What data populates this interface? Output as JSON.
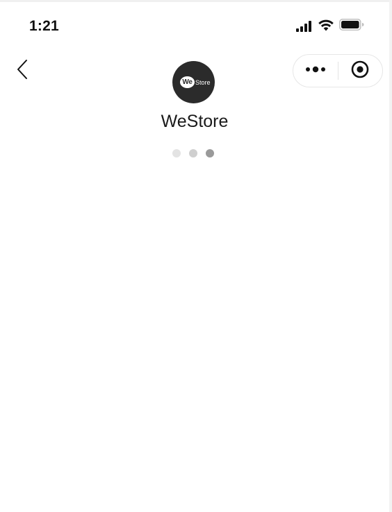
{
  "status_bar": {
    "time": "1:21",
    "icons": [
      "cellular-signal-icon",
      "wifi-icon",
      "battery-icon"
    ]
  },
  "nav": {
    "back_icon": "chevron-left-icon",
    "capsule": {
      "more_icon": "more-dots-icon",
      "close_icon": "target-close-icon"
    }
  },
  "app": {
    "logo_text_we": "We",
    "logo_text_store": "Store",
    "name": "WeStore"
  },
  "loading": {
    "dots": 3,
    "active_index": 2
  },
  "colors": {
    "dot_inactive_1": "#e3e3e3",
    "dot_inactive_2": "#cfcfcf",
    "dot_active": "#9a9a9a",
    "logo_bg": "#2b2b2b"
  }
}
